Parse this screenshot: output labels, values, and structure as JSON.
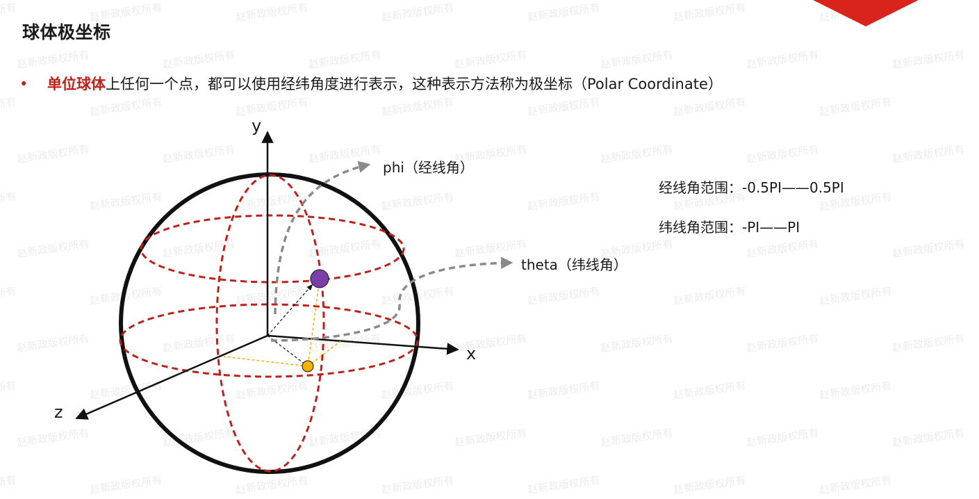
{
  "watermark_text": "赵新政版权所有",
  "title": "球体极坐标",
  "bullet": {
    "marker": "•",
    "lead": "单位球体",
    "text": "上任何一个点，都可以使用经纬角度进行表示，这种表示方法称为极坐标（Polar Coordinate）"
  },
  "diagram": {
    "axis_y": "y",
    "axis_x": "x",
    "axis_z": "z",
    "phi_label": "phi（经线角）",
    "theta_label": "theta（纬线角）"
  },
  "ranges": {
    "longitude": "经线角范围：-0.5PI——0.5PI",
    "latitude": "纬线角范围：-PI——PI"
  },
  "colors": {
    "accent_red": "#c0201a",
    "corner_red": "#d9241c",
    "sphere_outline": "#111111",
    "point_purple": "#7a3fa8",
    "projection_yellow": "#f0b400",
    "arrow_grey": "#8a8a8a"
  }
}
